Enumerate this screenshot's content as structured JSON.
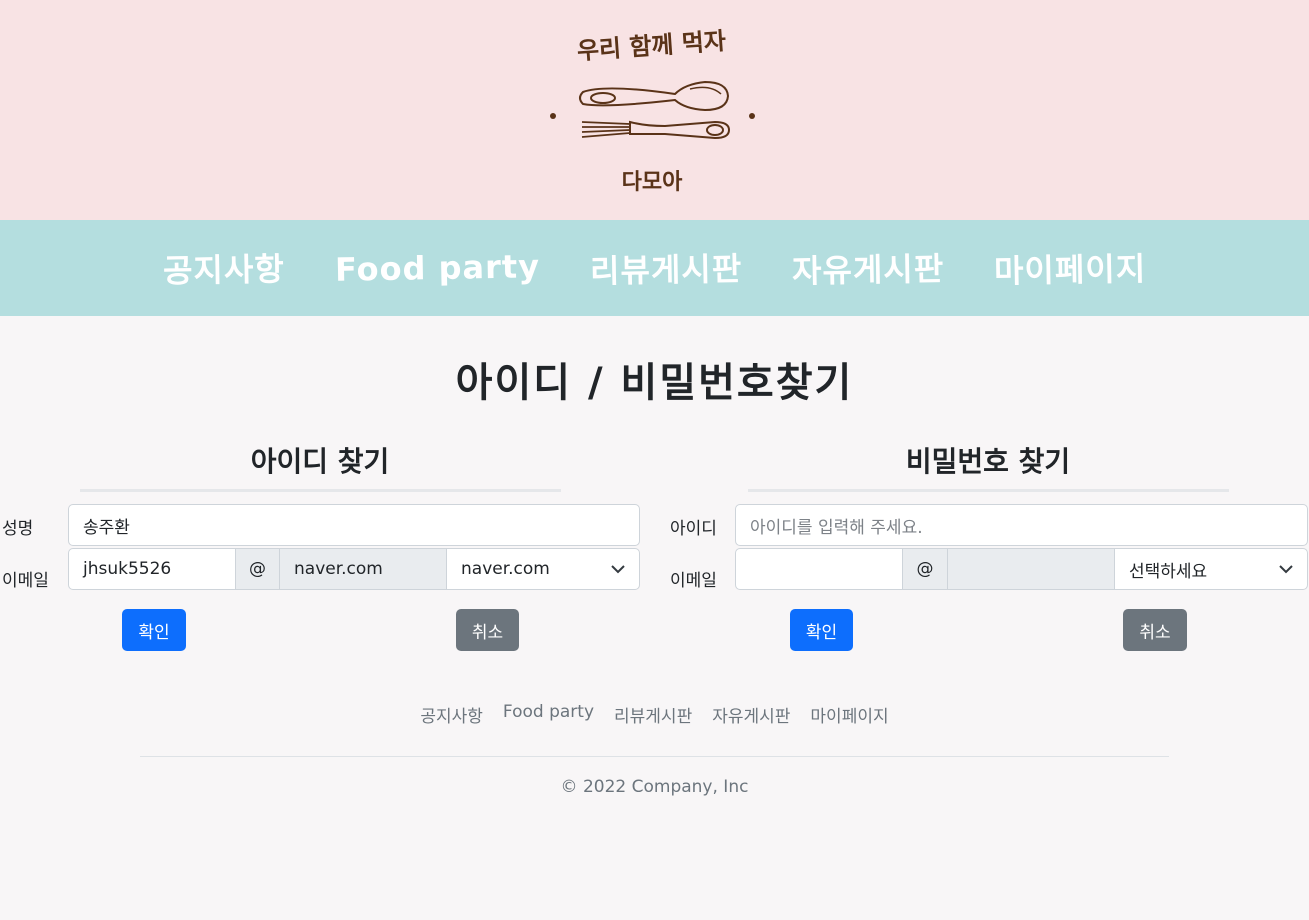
{
  "header": {
    "logo_top_text": "우리 함께 먹자",
    "logo_bottom_text": "다모아"
  },
  "nav": {
    "items": [
      "공지사항",
      "Food party",
      "리뷰게시판",
      "자유게시판",
      "마이페이지"
    ]
  },
  "page_title": "아이디 / 비밀번호찾기",
  "find_id": {
    "title": "아이디 찾기",
    "name_label": "성명",
    "name_value": "송주환",
    "email_label": "이메일",
    "email_id_value": "jhsuk5526",
    "at_sign": "@",
    "email_domain_value": "naver.com",
    "domain_select_value": "naver.com",
    "confirm_label": "확인",
    "cancel_label": "취소"
  },
  "find_pw": {
    "title": "비밀번호 찾기",
    "id_label": "아이디",
    "id_placeholder": "아이디를 입력해 주세요.",
    "email_label": "이메일",
    "email_id_value": "",
    "at_sign": "@",
    "email_domain_value": "",
    "domain_select_value": "선택하세요",
    "confirm_label": "확인",
    "cancel_label": "취소"
  },
  "footer": {
    "items": [
      "공지사항",
      "Food party",
      "리뷰게시판",
      "자유게시판",
      "마이페이지"
    ],
    "copyright": "© 2022 Company, Inc"
  },
  "colors": {
    "header_bg": "#f8e3e4",
    "nav_bg": "#b4dedf",
    "primary": "#0d6efd",
    "secondary": "#6c757d"
  }
}
